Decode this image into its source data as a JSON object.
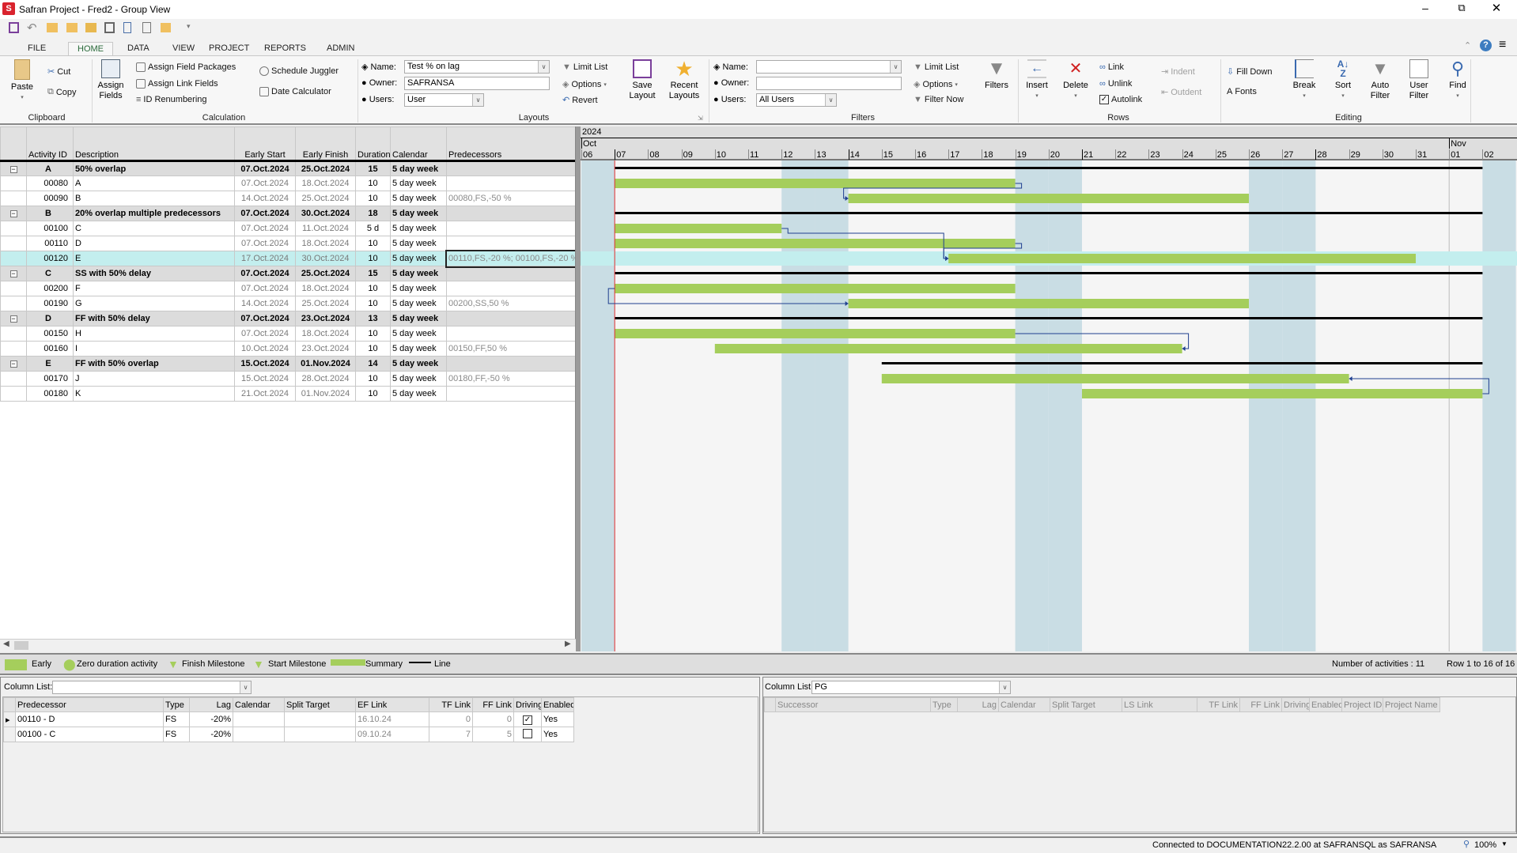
{
  "window": {
    "title": "Safran Project - Fred2 - Group View"
  },
  "tabs": [
    "FILE",
    "HOME",
    "DATA",
    "VIEW",
    "PROJECT",
    "REPORTS",
    "ADMIN"
  ],
  "active_tab": "HOME",
  "ribbon": {
    "clipboard": {
      "group": "Clipboard",
      "paste": "Paste",
      "cut": "Cut",
      "copy": "Copy"
    },
    "calculation": {
      "group": "Calculation",
      "assign_fields": "Assign Fields",
      "assign_field_packages": "Assign Field Packages",
      "assign_link_fields": "Assign Link Fields",
      "id_renumbering": "ID Renumbering",
      "schedule_juggler": "Schedule Juggler",
      "date_calculator": "Date Calculator"
    },
    "layouts": {
      "group": "Layouts",
      "name_label": "Name:",
      "name_value": "Test % on lag",
      "owner_label": "Owner:",
      "owner_value": "SAFRANSA",
      "users_label": "Users:",
      "users_value": "User",
      "limit_list": "Limit List",
      "options": "Options",
      "revert": "Revert",
      "save_layout": "Save Layout",
      "recent_layouts": "Recent Layouts"
    },
    "filters": {
      "group": "Filters",
      "name_label": "Name:",
      "name_value": "",
      "owner_label": "Owner:",
      "owner_value": "",
      "users_label": "Users:",
      "users_value": "All Users",
      "limit_list": "Limit List",
      "options": "Options",
      "filter_now": "Filter Now",
      "filters": "Filters"
    },
    "rows": {
      "group": "Rows",
      "insert": "Insert",
      "delete": "Delete",
      "link": "Link",
      "unlink": "Unlink",
      "autolink": "Autolink",
      "autolink_checked": true,
      "indent": "Indent",
      "outdent": "Outdent"
    },
    "editing": {
      "group": "Editing",
      "fill_down": "Fill Down",
      "fonts": "Fonts",
      "break": "Break",
      "sort": "Sort",
      "auto_filter": "Auto Filter",
      "user_filter": "User Filter",
      "find": "Find"
    }
  },
  "table": {
    "columns": [
      "",
      "Activity ID",
      "Description",
      "Early Start",
      "Early Finish",
      "Duration",
      "Calendar",
      "Predecessors"
    ],
    "selected_id": "00120",
    "rows": [
      {
        "summary": true,
        "id": "A",
        "desc": "50% overlap",
        "es": "07.Oct.2024",
        "ef": "25.Oct.2024",
        "dur": "15",
        "cal": "5 day week",
        "pred": ""
      },
      {
        "id": "00080",
        "desc": "A",
        "es": "07.Oct.2024",
        "ef": "18.Oct.2024",
        "dur": "10",
        "cal": "5 day week",
        "pred": ""
      },
      {
        "id": "00090",
        "desc": "B",
        "es": "14.Oct.2024",
        "ef": "25.Oct.2024",
        "dur": "10",
        "cal": "5 day week",
        "pred": "00080,FS,-50 %"
      },
      {
        "summary": true,
        "id": "B",
        "desc": "20% overlap multiple predecessors",
        "es": "07.Oct.2024",
        "ef": "30.Oct.2024",
        "dur": "18",
        "cal": "5 day week",
        "pred": ""
      },
      {
        "id": "00100",
        "desc": "C",
        "es": "07.Oct.2024",
        "ef": "11.Oct.2024",
        "dur": "5 d",
        "cal": "5 day week",
        "pred": ""
      },
      {
        "id": "00110",
        "desc": "D",
        "es": "07.Oct.2024",
        "ef": "18.Oct.2024",
        "dur": "10",
        "cal": "5 day week",
        "pred": ""
      },
      {
        "id": "00120",
        "desc": "E",
        "es": "17.Oct.2024",
        "ef": "30.Oct.2024",
        "dur": "10",
        "cal": "5 day week",
        "pred": "00110,FS,-20 %; 00100,FS,-20 %"
      },
      {
        "summary": true,
        "id": "C",
        "desc": "SS with 50% delay",
        "es": "07.Oct.2024",
        "ef": "25.Oct.2024",
        "dur": "15",
        "cal": "5 day week",
        "pred": ""
      },
      {
        "id": "00200",
        "desc": "F",
        "es": "07.Oct.2024",
        "ef": "18.Oct.2024",
        "dur": "10",
        "cal": "5 day week",
        "pred": ""
      },
      {
        "id": "00190",
        "desc": "G",
        "es": "14.Oct.2024",
        "ef": "25.Oct.2024",
        "dur": "10",
        "cal": "5 day week",
        "pred": "00200,SS,50 %"
      },
      {
        "summary": true,
        "id": "D",
        "desc": "FF with 50% delay",
        "es": "07.Oct.2024",
        "ef": "23.Oct.2024",
        "dur": "13",
        "cal": "5 day week",
        "pred": ""
      },
      {
        "id": "00150",
        "desc": "H",
        "es": "07.Oct.2024",
        "ef": "18.Oct.2024",
        "dur": "10",
        "cal": "5 day week",
        "pred": ""
      },
      {
        "id": "00160",
        "desc": "I",
        "es": "10.Oct.2024",
        "ef": "23.Oct.2024",
        "dur": "10",
        "cal": "5 day week",
        "pred": "00150,FF,50 %"
      },
      {
        "summary": true,
        "id": "E",
        "desc": "FF with 50% overlap",
        "es": "15.Oct.2024",
        "ef": "01.Nov.2024",
        "dur": "14",
        "cal": "5 day week",
        "pred": ""
      },
      {
        "id": "00170",
        "desc": "J",
        "es": "15.Oct.2024",
        "ef": "28.Oct.2024",
        "dur": "10",
        "cal": "5 day week",
        "pred": "00180,FF,-50 %"
      },
      {
        "id": "00180",
        "desc": "K",
        "es": "21.Oct.2024",
        "ef": "01.Nov.2024",
        "dur": "10",
        "cal": "5 day week",
        "pred": ""
      }
    ]
  },
  "gantt": {
    "year": "2024",
    "months": [
      {
        "label": "Oct",
        "start": "06.Oct.2024"
      },
      {
        "label": "Nov",
        "start": "01.Nov.2024"
      }
    ],
    "days": [
      "06",
      "07",
      "08",
      "09",
      "10",
      "11",
      "12",
      "13",
      "14",
      "15",
      "16",
      "17",
      "18",
      "19",
      "20",
      "21",
      "22",
      "23",
      "24",
      "25",
      "26",
      "27",
      "28",
      "29",
      "30",
      "31",
      "01",
      "02"
    ],
    "first_day": "06.Oct.2024",
    "data_date": "07.Oct.2024",
    "weekend_days": [
      "06",
      "12",
      "13",
      "19",
      "20",
      "26",
      "27",
      "02"
    ],
    "summary_line_end": "01.Nov.2024",
    "colors": {
      "bar": "#a5ce5c",
      "weekend": "#c9dde4",
      "selected": "#c3eeee",
      "link": "#1f3f8f",
      "data_date": "#e03030"
    },
    "links": [
      {
        "from": "00080",
        "to": "00090",
        "type": "FS"
      },
      {
        "from": "00110",
        "to": "00120",
        "type": "FS"
      },
      {
        "from": "00100",
        "to": "00120",
        "type": "FS"
      },
      {
        "from": "00200",
        "to": "00190",
        "type": "SS"
      },
      {
        "from": "00150",
        "to": "00160",
        "type": "FF"
      },
      {
        "from": "00180",
        "to": "00170",
        "type": "FF"
      }
    ]
  },
  "legend": {
    "items": [
      "Early",
      "Zero duration activity",
      "Finish Milestone",
      "Start Milestone",
      "Summary",
      "Line"
    ],
    "count": "Number of activities : 11",
    "rows": "Row 1 to 16 of 16"
  },
  "pred_panel": {
    "column_list_label": "Column List:",
    "column_list_value": "",
    "columns": [
      "Predecessor",
      "Type",
      "Lag",
      "Calendar",
      "Split Target",
      "EF Link",
      "TF Link",
      "FF Link",
      "Driving",
      "Enabled"
    ],
    "rows": [
      {
        "pred": "00110 - D",
        "type": "FS",
        "lag": "-20%",
        "cal": "",
        "split": "",
        "ef": "16.10.24",
        "tf": "0",
        "ff": "0",
        "driving": true,
        "enabled": "Yes"
      },
      {
        "pred": "00100 - C",
        "type": "FS",
        "lag": "-20%",
        "cal": "",
        "split": "",
        "ef": "09.10.24",
        "tf": "7",
        "ff": "5",
        "driving": false,
        "enabled": "Yes"
      }
    ]
  },
  "succ_panel": {
    "column_list_label": "Column List:",
    "column_list_value": "PG",
    "columns": [
      "Successor",
      "Type",
      "Lag",
      "Calendar",
      "Split Target",
      "LS Link",
      "TF Link",
      "FF Link",
      "Driving",
      "Enabled",
      "Project ID",
      "Project Name"
    ]
  },
  "status": {
    "connection": "Connected to DOCUMENTATION22.2.00 at SAFRANSQL as SAFRANSA",
    "zoom": "100%"
  }
}
